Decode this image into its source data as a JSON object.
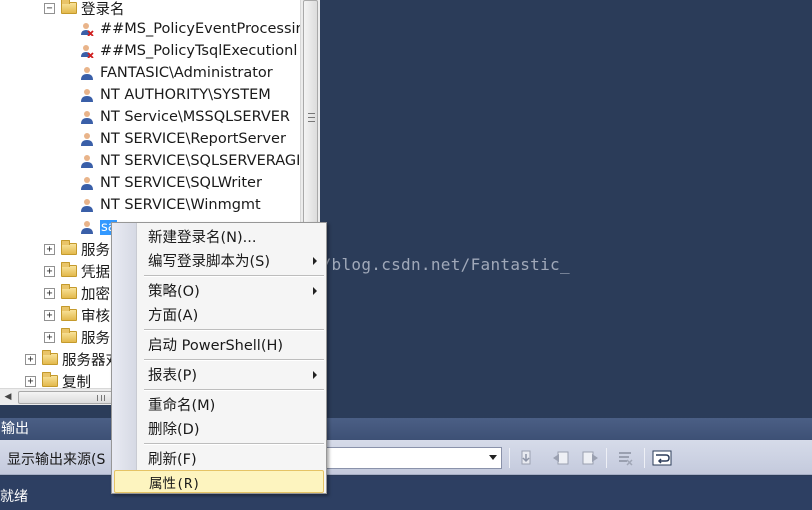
{
  "tree": {
    "logins_folder": "登录名",
    "logins": [
      "##MS_PolicyEventProcessir",
      "##MS_PolicyTsqlExecutionl",
      "FANTASIC\\Administrator",
      "NT AUTHORITY\\SYSTEM",
      "NT Service\\MSSQLSERVER",
      "NT SERVICE\\ReportServer",
      "NT SERVICE\\SQLSERVERAGI",
      "NT SERVICE\\SQLWriter",
      "NT SERVICE\\Winmgmt"
    ],
    "selected_login": "sa",
    "folders": [
      "服务",
      "凭据",
      "加密",
      "审核",
      "服务"
    ],
    "top_folders": [
      "服务器对",
      "复制"
    ]
  },
  "context_menu": {
    "items": {
      "new_login": "新建登录名(N)...",
      "script_login": "编写登录脚本为(S)",
      "policies": "策略(O)",
      "facets": "方面(A)",
      "powershell": "启动 PowerShell(H)",
      "reports": "报表(P)",
      "rename": "重命名(M)",
      "delete": "删除(D)",
      "refresh": "刷新(F)",
      "properties": "属性(R)"
    }
  },
  "watermark": "http://blog.csdn.net/Fantastic_",
  "output": {
    "title": "输出",
    "source_label": "显示输出来源(S"
  },
  "status": {
    "text": "就绪"
  },
  "colors": {
    "workspace": "#2b3c59",
    "selection": "#3399ff",
    "menu_hover": "#fdf4bf"
  }
}
